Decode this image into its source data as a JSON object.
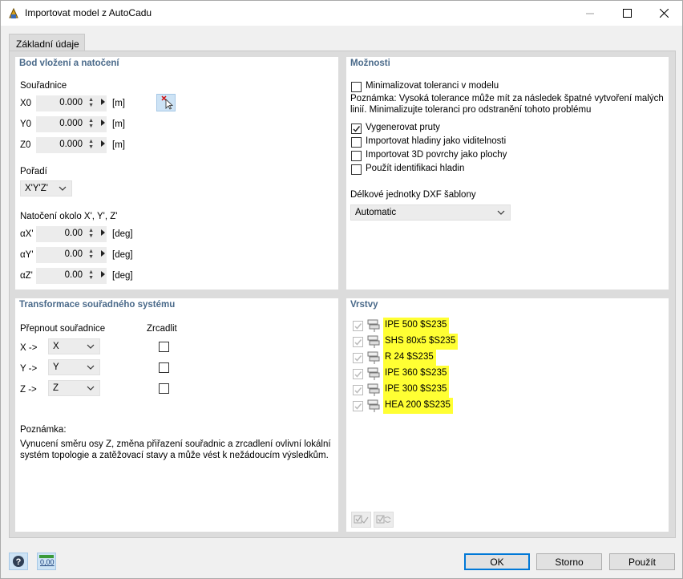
{
  "window": {
    "title": "Importovat model z AutoCadu"
  },
  "tabs": [
    {
      "label": "Základní údaje"
    }
  ],
  "insertion": {
    "title": "Bod vložení a natočení",
    "coords_label": "Souřadnice",
    "x": {
      "label": "X0",
      "value": "0.000",
      "unit": "[m]"
    },
    "y": {
      "label": "Y0",
      "value": "0.000",
      "unit": "[m]"
    },
    "z": {
      "label": "Z0",
      "value": "0.000",
      "unit": "[m]"
    },
    "order_label": "Pořadí",
    "order_value": "X'Y'Z'",
    "rotation_label": "Natočení okolo X', Y', Z'",
    "ax": {
      "label": "αX'",
      "value": "0.00",
      "unit": "[deg]"
    },
    "ay": {
      "label": "αY'",
      "value": "0.00",
      "unit": "[deg]"
    },
    "az": {
      "label": "αZ'",
      "value": "0.00",
      "unit": "[deg]"
    }
  },
  "options": {
    "title": "Možnosti",
    "minimize_tolerance": {
      "label": "Minimalizovat toleranci v modelu",
      "checked": false
    },
    "note": "Poznámka: Vysoká tolerance může mít za následek špatné vytvoření malých linií. Minimalizujte toleranci pro odstranění tohoto problému",
    "generate_members": {
      "label": "Vygenerovat pruty",
      "checked": true
    },
    "import_layers": {
      "label": "Importovat hladiny jako viditelnosti",
      "checked": false
    },
    "import_3d": {
      "label": "Importovat 3D povrchy jako plochy",
      "checked": false
    },
    "use_layer_id": {
      "label": "Použít identifikaci hladin",
      "checked": false
    },
    "dxf_units_label": "Délkové jednotky DXF šablony",
    "dxf_units_value": "Automatic"
  },
  "transform": {
    "title": "Transformace souřadného systému",
    "switch_label": "Přepnout souřadnice",
    "mirror_label": "Zrcadlit",
    "rows": [
      {
        "label": "X ->",
        "value": "X"
      },
      {
        "label": "Y ->",
        "value": "Y"
      },
      {
        "label": "Z ->",
        "value": "Z"
      }
    ],
    "note_title": "Poznámka:",
    "note_text": "Vynucení směru osy Z, změna přiřazení souřadnic a zrcadlení ovlivní lokální systém topologie a zatěžovací stavy a může vést k nežádoucím výsledkům."
  },
  "layers": {
    "title": "Vrstvy",
    "items": [
      "IPE 500 $S235",
      "SHS 80x5 $S235",
      "R 24 $S235",
      "IPE 360 $S235",
      "IPE 300 $S235",
      "HEA 200 $S235"
    ],
    "highlight_color": "#ffff33"
  },
  "footer": {
    "units_icon_text": "0,00",
    "ok": "OK",
    "cancel": "Storno",
    "apply": "Použít"
  },
  "colors": {
    "accent": "#0078d7",
    "panel_title": "#4a6a8a"
  }
}
